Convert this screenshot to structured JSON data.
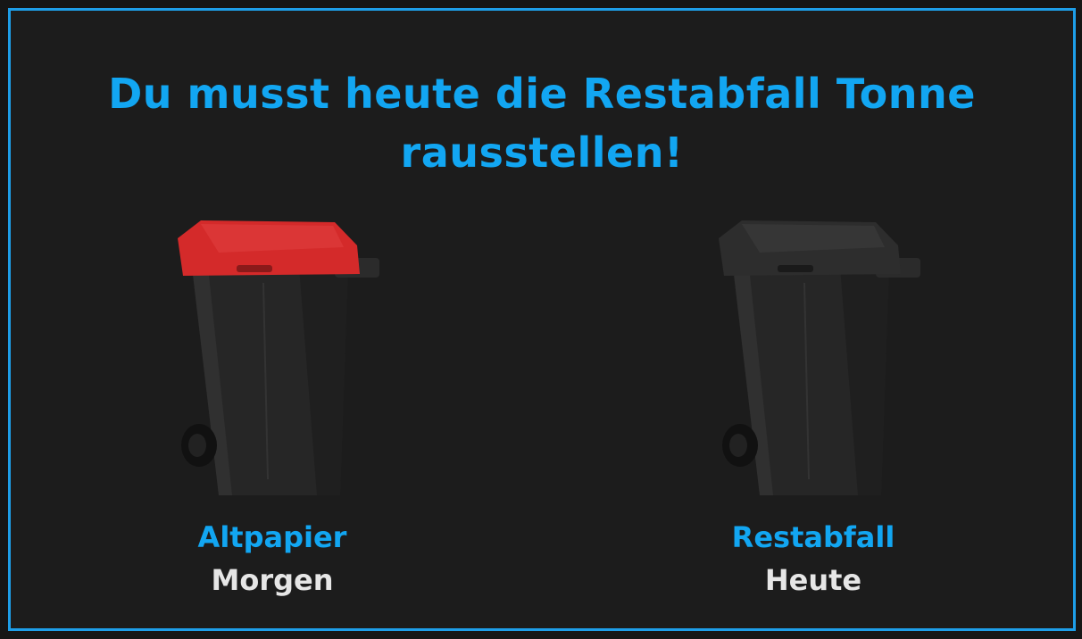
{
  "headline": "Du musst heute die Restabfall Tonne rausstellen!",
  "colors": {
    "accent": "#12a6f2",
    "border": "#1e9ee8",
    "background": "#1c1c1c",
    "day_text": "#e6e6e6",
    "bin_body": "#2a2a2a",
    "lid_altpapier": "#d42a2a",
    "lid_restabfall": "#2d2d2d"
  },
  "bins": [
    {
      "name": "Altpapier",
      "day": "Morgen",
      "icon": "red-lid-waste-bin-icon"
    },
    {
      "name": "Restabfall",
      "day": "Heute",
      "icon": "black-waste-bin-icon"
    }
  ]
}
